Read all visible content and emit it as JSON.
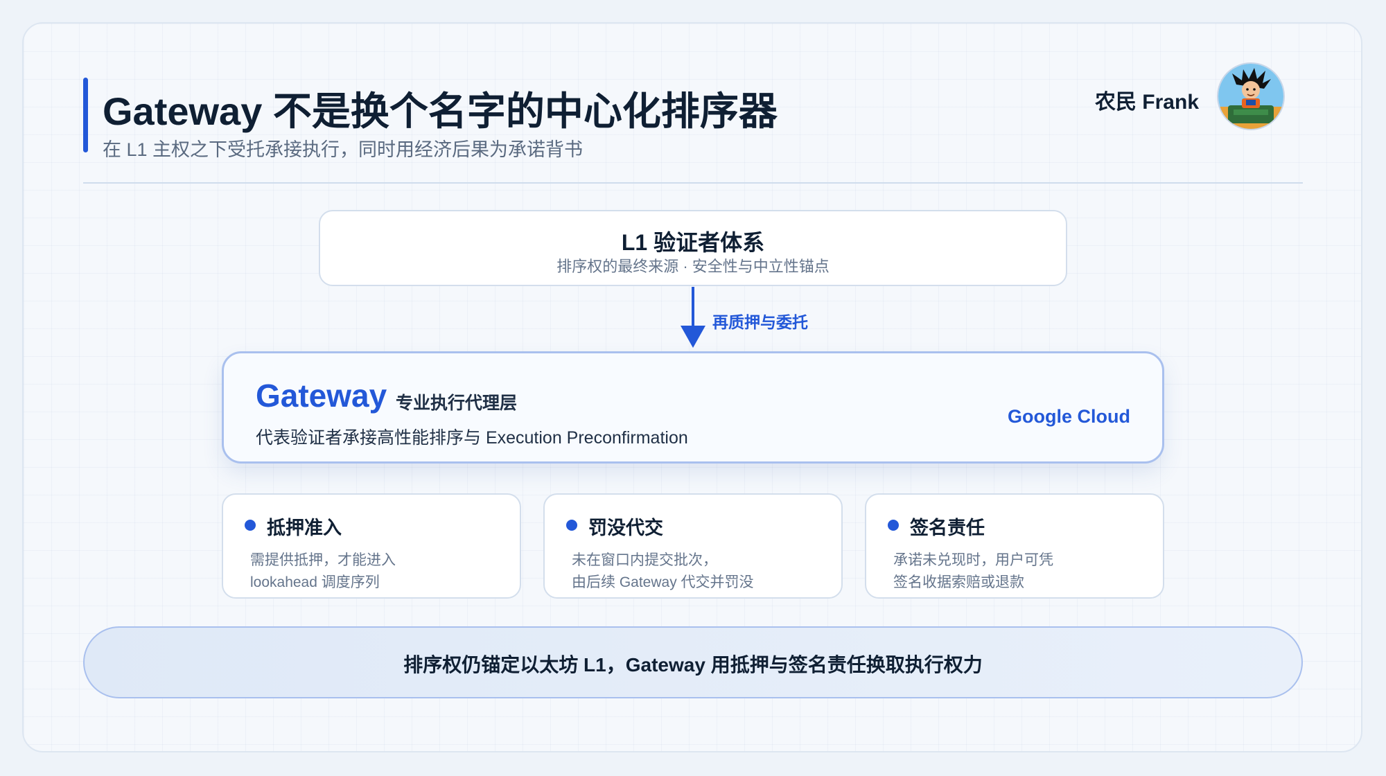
{
  "header": {
    "title": "Gateway 不是换个名字的中心化排序器",
    "subtitle": "在 L1 主权之下受托承接执行，同时用经济后果为承诺背书",
    "author": "农民 Frank",
    "avatar_icon": "cartoon-character-avatar"
  },
  "l1": {
    "title": "L1 验证者体系",
    "description": "排序权的最终来源 · 安全性与中立性锚点"
  },
  "flow": {
    "arrow_label": "再质押与委托"
  },
  "gateway": {
    "title": "Gateway",
    "tag": "专业执行代理层",
    "description": "代表验证者承接高性能排序与 Execution Preconfirmation",
    "brand": "Google Cloud"
  },
  "cards": [
    {
      "title": "抵押准入",
      "line1": "需提供抵押，才能进入",
      "line2": "lookahead 调度序列"
    },
    {
      "title": "罚没代交",
      "line1": "未在窗口内提交批次，",
      "line2": "由后续 Gateway 代交并罚没"
    },
    {
      "title": "签名责任",
      "line1": "承诺未兑现时，用户可凭",
      "line2": "签名收据索赔或退款"
    }
  ],
  "banner": {
    "text": "排序权仍锚定以太坊 L1，Gateway 用抵押与签名责任换取执行权力"
  },
  "colors": {
    "accent": "#2358d8",
    "text": "#0f1f33",
    "muted": "#64748b",
    "border": "#d3deec"
  }
}
